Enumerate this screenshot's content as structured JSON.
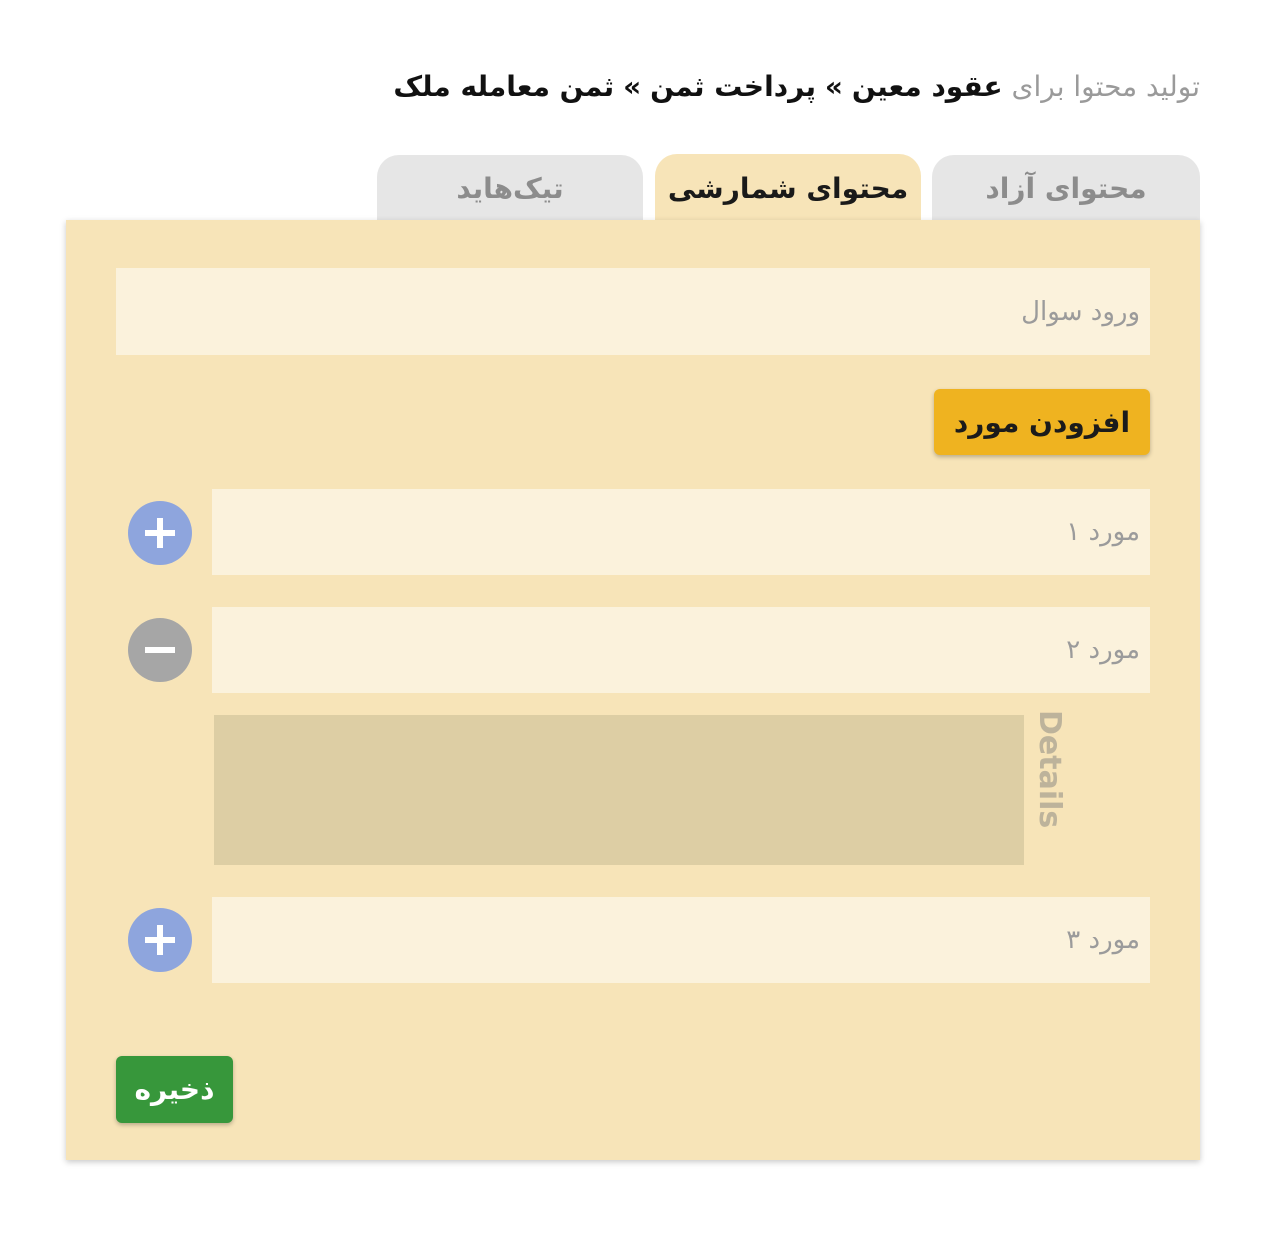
{
  "breadcrumb": {
    "prefix": "تولید محتوا برای",
    "parts": [
      "عقود معین",
      "پرداخت ثمن",
      "ثمن معامله ملک"
    ],
    "separator": "»"
  },
  "tabs": [
    {
      "label": "محتوای آزاد",
      "active": false
    },
    {
      "label": "محتوای شمارشی",
      "active": true
    },
    {
      "label": "تیک‌هاید",
      "active": false
    }
  ],
  "form": {
    "question_placeholder": "ورود سوال",
    "add_item_label": "افزودن مورد",
    "items": [
      {
        "placeholder": "مورد ۱",
        "action_icon": "plus-icon"
      },
      {
        "placeholder": "مورد ۲",
        "action_icon": "minus-icon"
      },
      {
        "placeholder": "مورد ۳",
        "action_icon": "plus-icon"
      }
    ],
    "details_label": "Details",
    "save_label": "ذخیره"
  },
  "colors": {
    "panel": "#f7e4b8",
    "field": "#fbf2dc",
    "add_button": "#efb320",
    "plus_circle": "#8ea5dd",
    "minus_circle": "#a6a6a6",
    "save_button": "#37973b",
    "details_area": "#ddcea4"
  }
}
